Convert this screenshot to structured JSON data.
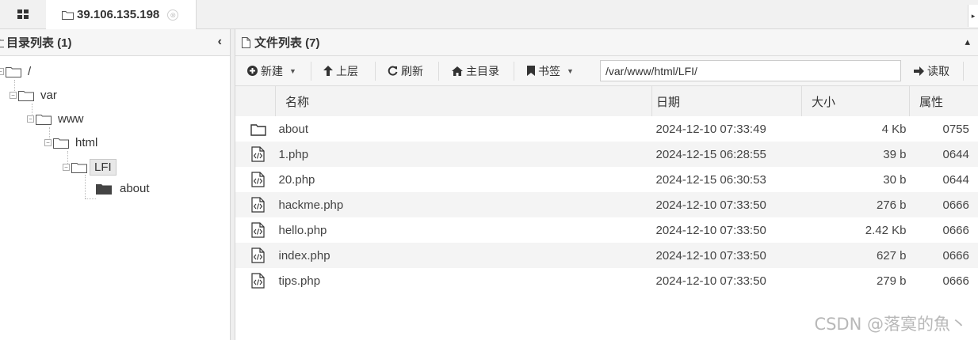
{
  "tabbar": {
    "grid_icon": "grid-icon",
    "tab_label": "39.106.135.198",
    "tab_icon": "folder-icon",
    "close_glyph": "⊗",
    "scroll_glyph": "▸"
  },
  "left_panel": {
    "title": "目录列表 (1)",
    "collapse_glyph": "‹",
    "tree": [
      {
        "label": "/",
        "level": 0
      },
      {
        "label": "var",
        "level": 1
      },
      {
        "label": "www",
        "level": 2
      },
      {
        "label": "html",
        "level": 3
      },
      {
        "label": "LFI",
        "level": 4,
        "selected": true
      },
      {
        "label": "about",
        "level": 5
      }
    ]
  },
  "right_panel": {
    "title": "文件列表 (7)",
    "collapse_glyph": "▴",
    "toolbar": {
      "new_label": "新建",
      "up_label": "上层",
      "refresh_label": "刷新",
      "home_label": "主目录",
      "bookmark_label": "书签",
      "path_value": "/var/www/html/LFI/",
      "read_label": "读取"
    },
    "columns": [
      "名称",
      "日期",
      "大小",
      "属性"
    ],
    "files": [
      {
        "name": "about",
        "type": "folder",
        "date": "2024-12-10 07:33:49",
        "size": "4 Kb",
        "perm": "0755"
      },
      {
        "name": "1.php",
        "type": "code",
        "date": "2024-12-15 06:28:55",
        "size": "39 b",
        "perm": "0644"
      },
      {
        "name": "20.php",
        "type": "code",
        "date": "2024-12-15 06:30:53",
        "size": "30 b",
        "perm": "0644"
      },
      {
        "name": "hackme.php",
        "type": "code",
        "date": "2024-12-10 07:33:50",
        "size": "276 b",
        "perm": "0666"
      },
      {
        "name": "hello.php",
        "type": "code",
        "date": "2024-12-10 07:33:50",
        "size": "2.42 Kb",
        "perm": "0666"
      },
      {
        "name": "index.php",
        "type": "code",
        "date": "2024-12-10 07:33:50",
        "size": "627 b",
        "perm": "0666"
      },
      {
        "name": "tips.php",
        "type": "code",
        "date": "2024-12-10 07:33:50",
        "size": "279 b",
        "perm": "0666"
      }
    ]
  },
  "watermark": "CSDN @落寞的魚丶"
}
